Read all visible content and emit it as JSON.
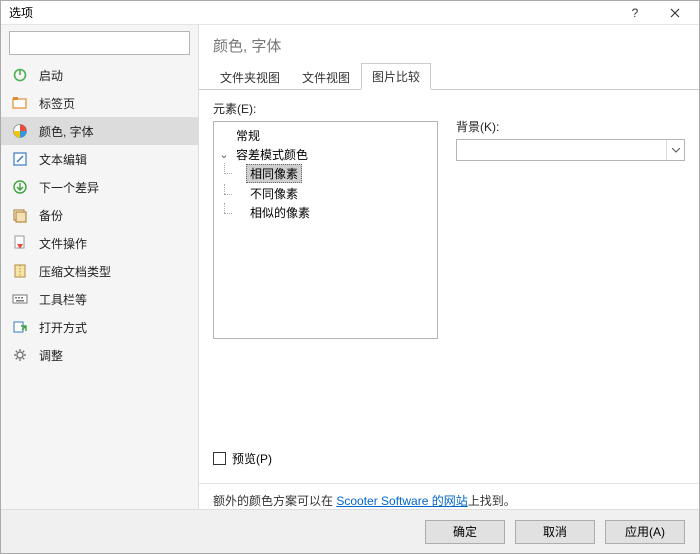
{
  "window": {
    "title": "选项",
    "help": "?",
    "close": "🗙"
  },
  "search": {
    "placeholder": ""
  },
  "sidebar": {
    "items": [
      {
        "label": "启动"
      },
      {
        "label": "标签页"
      },
      {
        "label": "颜色, 字体"
      },
      {
        "label": "文本编辑"
      },
      {
        "label": "下一个差异"
      },
      {
        "label": "备份"
      },
      {
        "label": "文件操作"
      },
      {
        "label": "压缩文档类型"
      },
      {
        "label": "工具栏等"
      },
      {
        "label": "打开方式"
      },
      {
        "label": "调整"
      }
    ]
  },
  "main": {
    "title": "颜色, 字体",
    "tabs": [
      {
        "label": "文件夹视图"
      },
      {
        "label": "文件视图"
      },
      {
        "label": "图片比较"
      }
    ],
    "elementsLabel": "元素(E):",
    "backgroundLabel": "背景(K):",
    "backgroundValue": "",
    "tree": {
      "root1": "常规",
      "root2": "容差模式颜色",
      "children": [
        {
          "label": "相同像素",
          "selected": true
        },
        {
          "label": "不同像素"
        },
        {
          "label": "相似的像素"
        }
      ]
    },
    "previewLabel": "预览(P)",
    "footnotePrefix": "额外的颜色方案可以在 ",
    "footnoteLink": "Scooter Software 的网站",
    "footnoteSuffix": "上找到。"
  },
  "buttons": {
    "ok": "确定",
    "cancel": "取消",
    "apply": "应用(A)"
  }
}
